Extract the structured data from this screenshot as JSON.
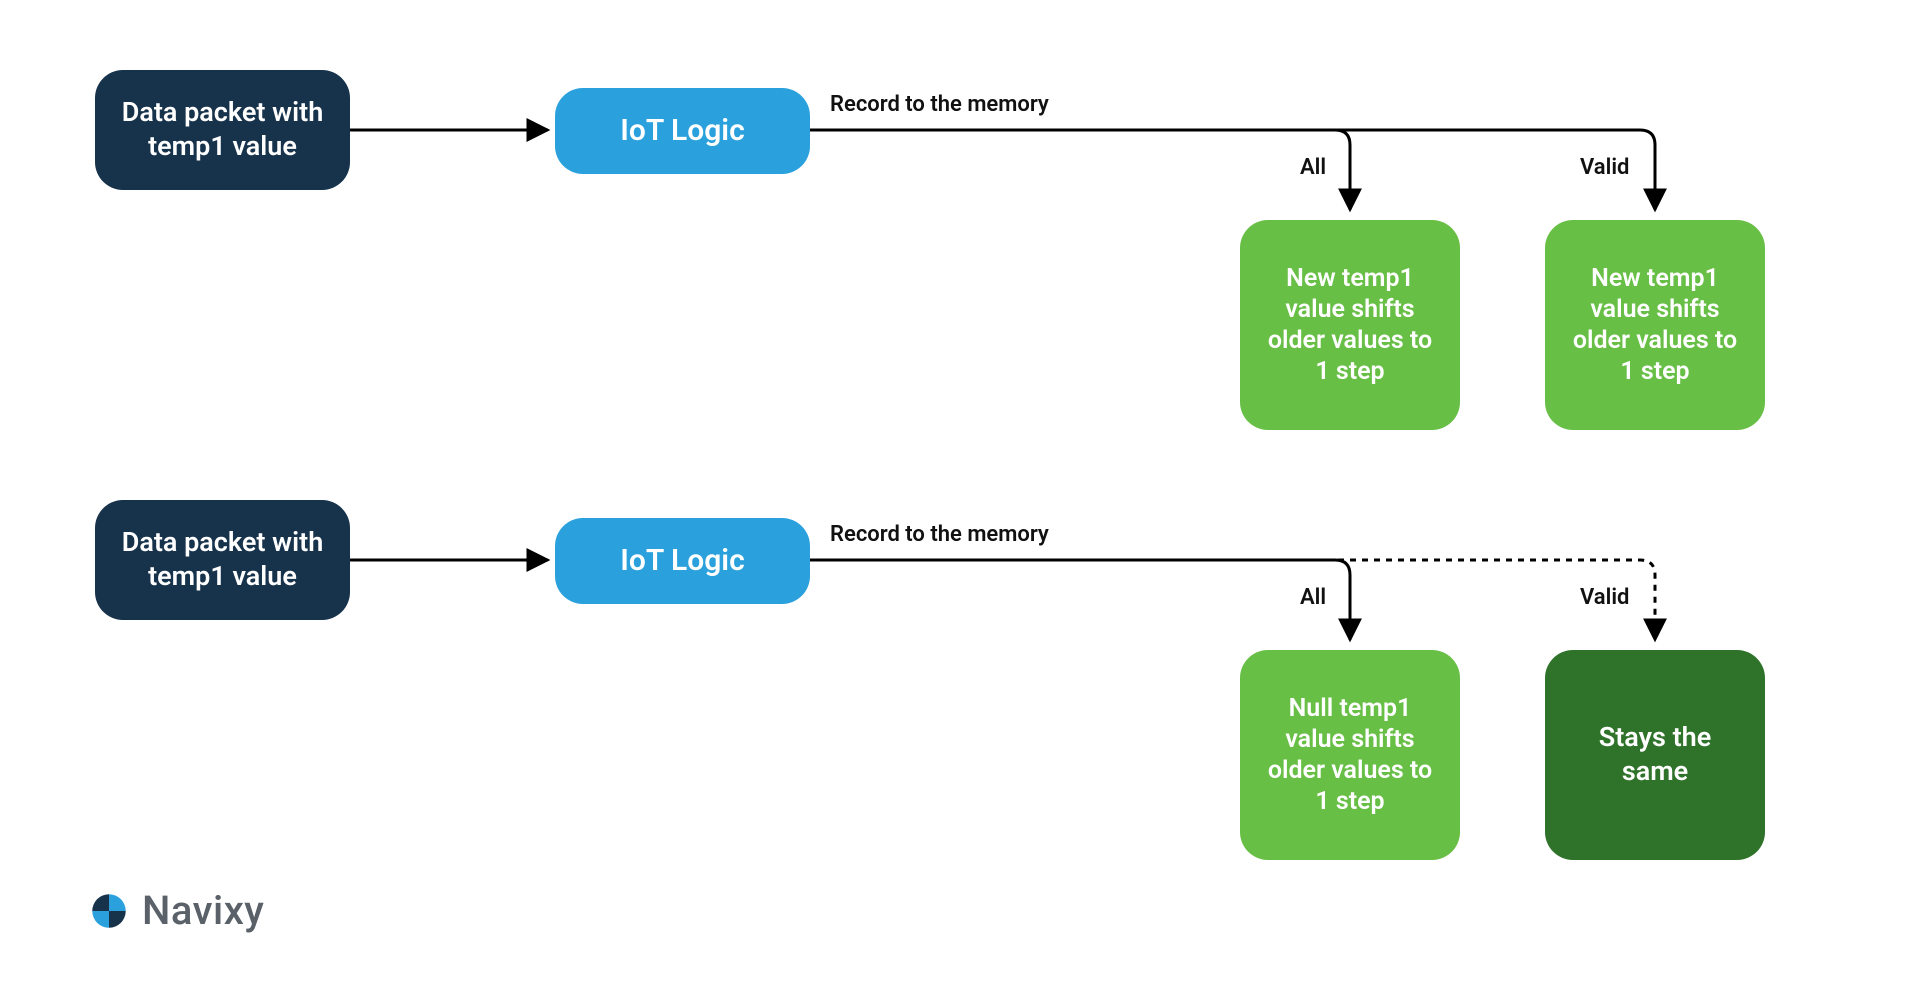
{
  "flow1": {
    "source": "Data packet with temp1 value",
    "process": "IoT Logic",
    "edge": "Record to the memory",
    "branchA": {
      "label": "All",
      "result": "New temp1 value shifts older values to 1 step"
    },
    "branchB": {
      "label": "Valid",
      "result": "New temp1 value shifts older values to 1 step"
    }
  },
  "flow2": {
    "source": "Data packet with temp1 value",
    "process": "IoT Logic",
    "edge": "Record to the memory",
    "branchA": {
      "label": "All",
      "result": "Null temp1 value shifts older values to 1 step"
    },
    "branchB": {
      "label": "Valid",
      "result": "Stays the same"
    }
  },
  "brand": "Navixy"
}
